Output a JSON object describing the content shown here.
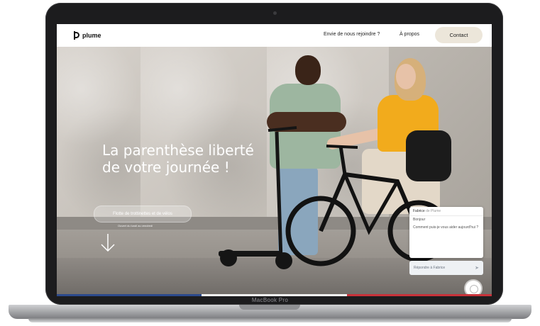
{
  "nav": {
    "logo_text": "plume",
    "links": [
      "Envie de nous rejoindre ?",
      "À propos"
    ],
    "contact_label": "Contact"
  },
  "hero": {
    "title_line1": "La parenthèse liberté",
    "title_line2": "de votre journée !",
    "pill_label": "Flotte de trottinettes et de vélos",
    "small_line": "Ouvert du lundi au vendredi"
  },
  "chat": {
    "agent_name": "Fabrice",
    "agent_sub": "de Plume",
    "messages": [
      "Bonjour",
      "Comment puis-je vous aider aujourd'hui ?"
    ],
    "input_placeholder": "Répondre à Fabrice"
  },
  "device": {
    "model_label": "MacBook Pro"
  },
  "colors": {
    "flag_blue": "#2c4a8c",
    "flag_white": "#f2f2f2",
    "flag_red": "#c8323a"
  }
}
